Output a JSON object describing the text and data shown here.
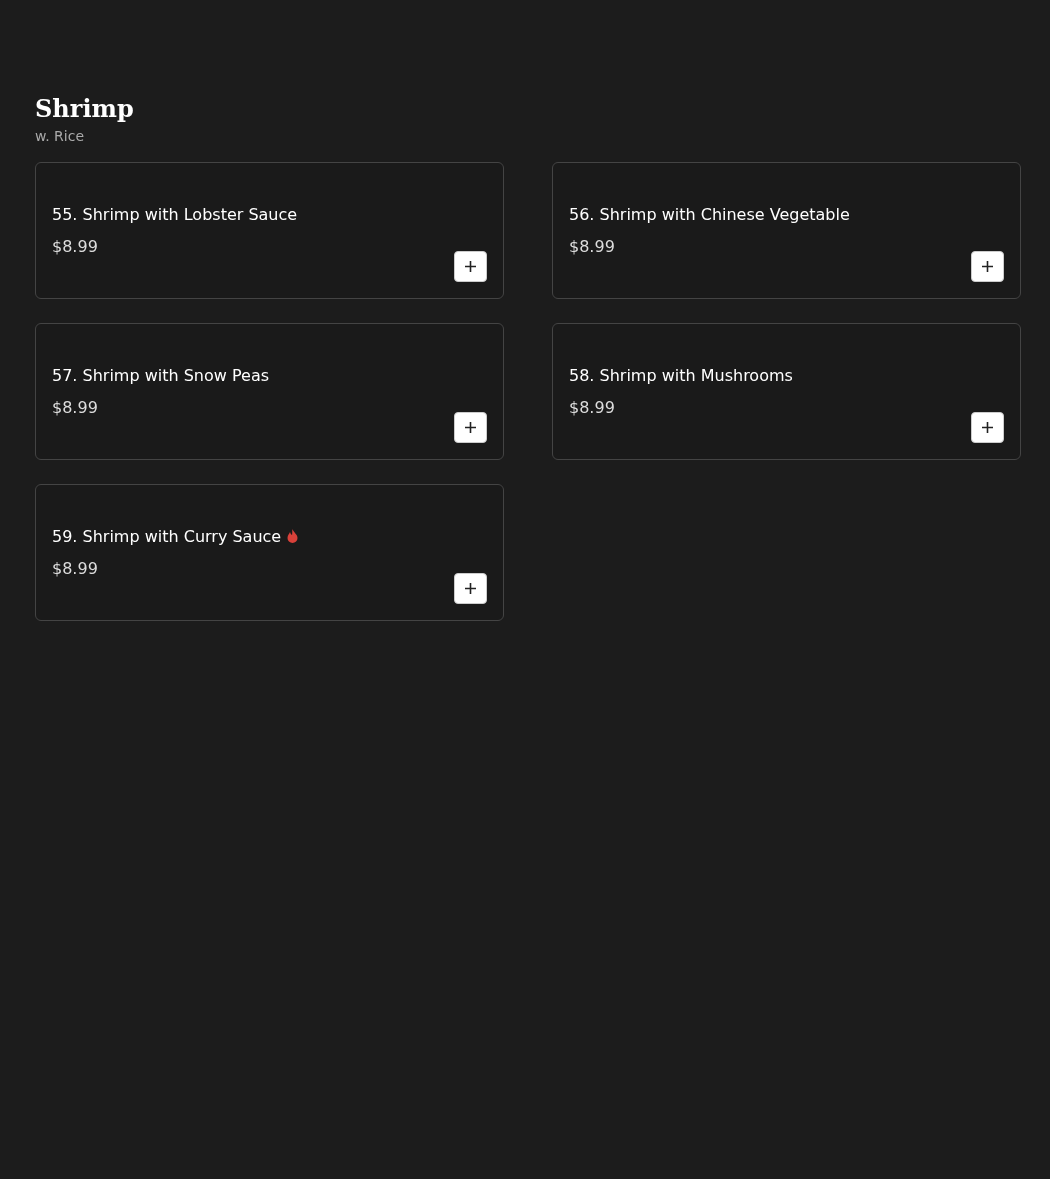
{
  "section": {
    "title": "Shrimp",
    "subtitle": "w. Rice"
  },
  "items": [
    {
      "name": "55. Shrimp with Lobster Sauce",
      "price": "$8.99",
      "spicy": false
    },
    {
      "name": "56. Shrimp with Chinese Vegetable",
      "price": "$8.99",
      "spicy": false
    },
    {
      "name": "57. Shrimp with Snow Peas",
      "price": "$8.99",
      "spicy": false
    },
    {
      "name": "58. Shrimp with Mushrooms",
      "price": "$8.99",
      "spicy": false
    },
    {
      "name": "59. Shrimp with Curry Sauce",
      "price": "$8.99",
      "spicy": true
    }
  ]
}
